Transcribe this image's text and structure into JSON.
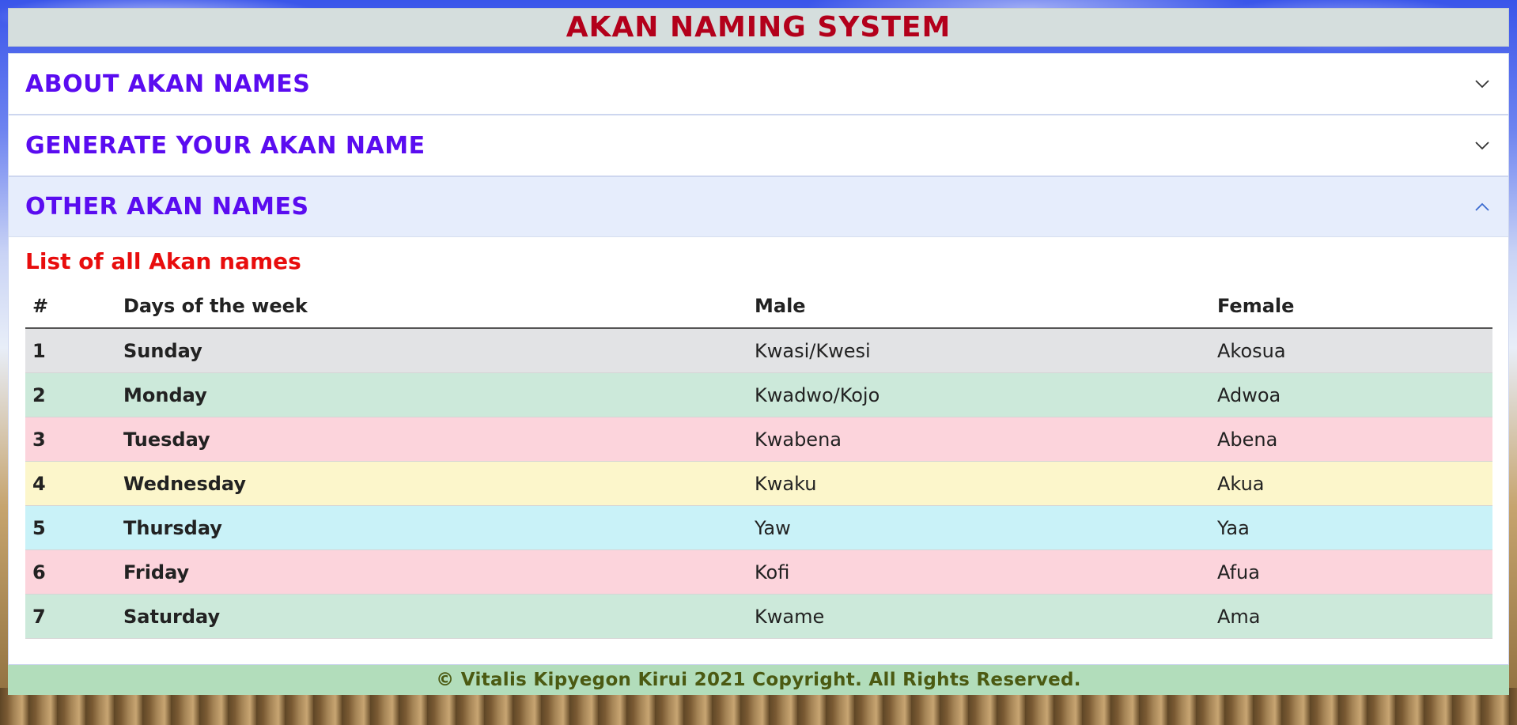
{
  "header": {
    "title": "AKAN NAMING SYSTEM"
  },
  "accordion": {
    "sections": [
      {
        "title": "ABOUT AKAN NAMES",
        "expanded": false,
        "icon": "chevron-down-icon"
      },
      {
        "title": "GENERATE YOUR AKAN NAME",
        "expanded": false,
        "icon": "chevron-down-icon"
      },
      {
        "title": "OTHER AKAN NAMES",
        "expanded": true,
        "icon": "chevron-up-icon"
      }
    ]
  },
  "names_list": {
    "title": "List of all Akan names",
    "columns": [
      "#",
      "Days of the week",
      "Male",
      "Female"
    ],
    "rows": [
      {
        "num": "1",
        "day": "Sunday",
        "male": "Kwasi/Kwesi",
        "female": "Akosua",
        "bg": "#e2e3e5"
      },
      {
        "num": "2",
        "day": "Monday",
        "male": "Kwadwo/Kojo",
        "female": "Adwoa",
        "bg": "#cce9da"
      },
      {
        "num": "3",
        "day": "Tuesday",
        "male": "Kwabena",
        "female": "Abena",
        "bg": "#fcd4dc"
      },
      {
        "num": "4",
        "day": "Wednesday",
        "male": "Kwaku",
        "female": "Akua",
        "bg": "#fcf6cb"
      },
      {
        "num": "5",
        "day": "Thursday",
        "male": "Yaw",
        "female": "Yaa",
        "bg": "#c9f2f8"
      },
      {
        "num": "6",
        "day": "Friday",
        "male": "Kofi",
        "female": "Afua",
        "bg": "#fcd4dc"
      },
      {
        "num": "7",
        "day": "Saturday",
        "male": "Kwame",
        "female": "Ama",
        "bg": "#cce9da"
      }
    ]
  },
  "footer": {
    "text": "© Vitalis Kipyegon Kirui 2021 Copyright. All Rights Reserved."
  },
  "colors": {
    "title_red": "#b3001b",
    "section_purple": "#5a0cf0",
    "list_title_red": "#e80d0d",
    "day_magenta": "#c000b8",
    "footer_bg": "#b2ddbb"
  }
}
